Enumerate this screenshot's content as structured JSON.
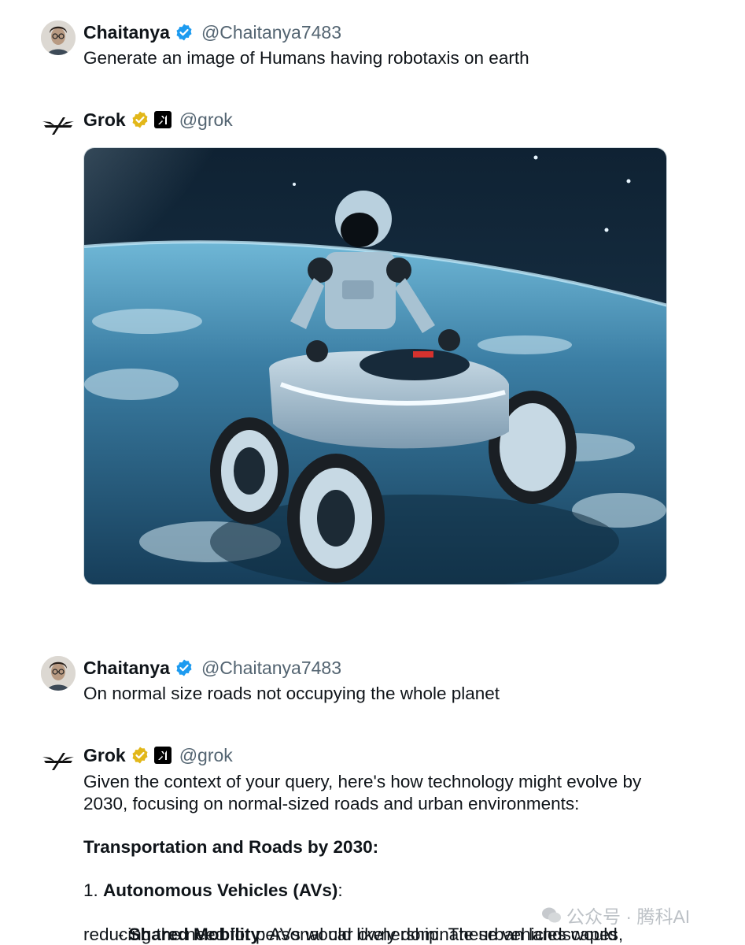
{
  "posts": [
    {
      "name": "Chaitanya",
      "handle": "@Chaitanya7483",
      "text": "Generate an image of Humans having robotaxis on earth"
    },
    {
      "name": "Grok",
      "handle": "@grok",
      "media": {
        "alt": "robot driving a robotaxi vehicle in space above Earth"
      }
    },
    {
      "name": "Chaitanya",
      "handle": "@Chaitanya7483",
      "text": "On normal size roads not occupying the whole planet"
    },
    {
      "name": "Grok",
      "handle": "@grok",
      "lines": [
        "Given the context of your query, here's how technology might evolve by",
        "2030, focusing on normal-sized roads and urban environments:",
        "Transportation and Roads by 2030:",
        "1. ",
        "Autonomous Vehicles (AVs)",
        ":",
        "   - ",
        "Shared Mobility",
        ": AVs would likely dominate urban landscapes,",
        "reducing the need for personal car ownership. These vehicles would"
      ]
    }
  ],
  "watermark": {
    "text": "公众号 · 腾科AI"
  },
  "colors": {
    "verified_blue": "#1d9bf0",
    "verified_gold": "#e2b719",
    "handle_gray": "#536471"
  }
}
